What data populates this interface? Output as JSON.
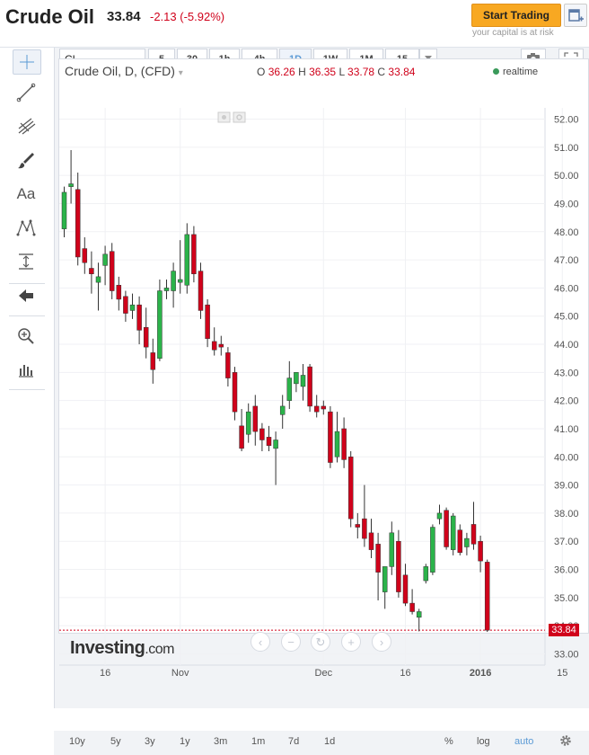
{
  "header": {
    "title": "Crude Oil",
    "price": "33.84",
    "change": "-2.13 (-5.92%)",
    "start_trading": "Start Trading",
    "risk_note": "your capital is at risk"
  },
  "toolbar": {
    "symbol": "CL",
    "timeframes": [
      "5",
      "30",
      "1h",
      "4h",
      "1D",
      "1W",
      "1M",
      "15"
    ],
    "active_timeframe": "1D"
  },
  "legend": {
    "name": "Crude Oil, D, (CFD)",
    "o_label": "O",
    "o": "36.26",
    "h_label": "H",
    "h": "36.35",
    "l_label": "L",
    "l": "33.78",
    "c_label": "C",
    "c": "33.84",
    "realtime": "realtime"
  },
  "logo": {
    "brand": "Investing",
    "suffix": ".com"
  },
  "last_price_label": "33.84",
  "bottom": {
    "ranges": [
      "10y",
      "5y",
      "3y",
      "1y",
      "3m",
      "1m",
      "7d",
      "1d"
    ],
    "pct": "%",
    "log": "log",
    "auto": "auto"
  },
  "colors": {
    "up": "#2bb34a",
    "down": "#d0021b",
    "accent": "#5b9ad5",
    "button": "#f8a822"
  },
  "chart_data": {
    "type": "candlestick",
    "title": "Crude Oil, D, (CFD)",
    "y_ticks": [
      "52.00",
      "51.00",
      "50.00",
      "49.00",
      "48.00",
      "47.00",
      "46.00",
      "45.00",
      "44.00",
      "43.00",
      "42.00",
      "41.00",
      "40.00",
      "39.00",
      "38.00",
      "37.00",
      "36.00",
      "35.00",
      "34.00",
      "33.00"
    ],
    "ylim": [
      32.6,
      52.4
    ],
    "x_ticks": [
      {
        "label": "16",
        "i": 6
      },
      {
        "label": "Nov",
        "i": 17
      },
      {
        "label": "Dec",
        "i": 38
      },
      {
        "label": "16",
        "i": 50
      },
      {
        "label": "2016",
        "i": 61
      },
      {
        "label": "15",
        "i": 73
      }
    ],
    "candles": [
      {
        "o": 48.1,
        "h": 49.6,
        "l": 47.8,
        "c": 49.4
      },
      {
        "o": 49.6,
        "h": 50.9,
        "l": 49.0,
        "c": 49.7
      },
      {
        "o": 49.5,
        "h": 50.1,
        "l": 46.8,
        "c": 47.1
      },
      {
        "o": 47.4,
        "h": 47.8,
        "l": 46.5,
        "c": 46.9
      },
      {
        "o": 46.7,
        "h": 47.3,
        "l": 45.8,
        "c": 46.5
      },
      {
        "o": 46.2,
        "h": 46.9,
        "l": 45.2,
        "c": 46.4
      },
      {
        "o": 46.8,
        "h": 47.5,
        "l": 46.1,
        "c": 47.2
      },
      {
        "o": 47.3,
        "h": 47.6,
        "l": 45.6,
        "c": 45.9
      },
      {
        "o": 46.1,
        "h": 46.4,
        "l": 45.2,
        "c": 45.6
      },
      {
        "o": 45.7,
        "h": 45.9,
        "l": 44.8,
        "c": 45.1
      },
      {
        "o": 45.2,
        "h": 45.8,
        "l": 44.9,
        "c": 45.4
      },
      {
        "o": 45.4,
        "h": 45.7,
        "l": 44.0,
        "c": 44.5
      },
      {
        "o": 44.6,
        "h": 45.3,
        "l": 43.5,
        "c": 43.9
      },
      {
        "o": 43.7,
        "h": 44.2,
        "l": 42.6,
        "c": 43.1
      },
      {
        "o": 43.5,
        "h": 46.3,
        "l": 43.4,
        "c": 45.9
      },
      {
        "o": 45.9,
        "h": 46.3,
        "l": 45.6,
        "c": 46.0
      },
      {
        "o": 45.9,
        "h": 46.9,
        "l": 45.3,
        "c": 46.6
      },
      {
        "o": 46.2,
        "h": 47.7,
        "l": 45.8,
        "c": 46.3
      },
      {
        "o": 46.1,
        "h": 48.3,
        "l": 45.8,
        "c": 47.9
      },
      {
        "o": 47.9,
        "h": 48.2,
        "l": 46.2,
        "c": 46.5
      },
      {
        "o": 46.6,
        "h": 46.9,
        "l": 44.9,
        "c": 45.2
      },
      {
        "o": 45.4,
        "h": 45.6,
        "l": 43.9,
        "c": 44.2
      },
      {
        "o": 44.1,
        "h": 44.6,
        "l": 43.6,
        "c": 43.8
      },
      {
        "o": 44.0,
        "h": 44.3,
        "l": 43.6,
        "c": 43.9
      },
      {
        "o": 43.7,
        "h": 43.9,
        "l": 42.5,
        "c": 42.8
      },
      {
        "o": 43.0,
        "h": 43.2,
        "l": 41.3,
        "c": 41.6
      },
      {
        "o": 41.1,
        "h": 41.7,
        "l": 40.2,
        "c": 40.3
      },
      {
        "o": 40.8,
        "h": 41.9,
        "l": 40.5,
        "c": 41.6
      },
      {
        "o": 41.8,
        "h": 42.2,
        "l": 40.4,
        "c": 40.9
      },
      {
        "o": 41.0,
        "h": 41.2,
        "l": 40.2,
        "c": 40.6
      },
      {
        "o": 40.7,
        "h": 41.1,
        "l": 40.2,
        "c": 40.4
      },
      {
        "o": 40.3,
        "h": 40.9,
        "l": 39.0,
        "c": 40.6
      },
      {
        "o": 41.5,
        "h": 42.2,
        "l": 41.0,
        "c": 41.8
      },
      {
        "o": 42.0,
        "h": 43.4,
        "l": 41.7,
        "c": 42.8
      },
      {
        "o": 42.6,
        "h": 43.0,
        "l": 42.3,
        "c": 43.0
      },
      {
        "o": 42.5,
        "h": 43.3,
        "l": 42.0,
        "c": 42.9
      },
      {
        "o": 43.2,
        "h": 43.3,
        "l": 41.6,
        "c": 41.8
      },
      {
        "o": 41.8,
        "h": 42.2,
        "l": 41.4,
        "c": 41.6
      },
      {
        "o": 41.8,
        "h": 42.0,
        "l": 41.5,
        "c": 41.7
      },
      {
        "o": 41.6,
        "h": 41.8,
        "l": 39.6,
        "c": 39.8
      },
      {
        "o": 40.0,
        "h": 41.6,
        "l": 39.8,
        "c": 40.9
      },
      {
        "o": 41.0,
        "h": 41.4,
        "l": 39.6,
        "c": 39.9
      },
      {
        "o": 40.0,
        "h": 40.2,
        "l": 37.5,
        "c": 37.8
      },
      {
        "o": 37.6,
        "h": 38.0,
        "l": 37.1,
        "c": 37.5
      },
      {
        "o": 37.8,
        "h": 39.0,
        "l": 36.8,
        "c": 37.1
      },
      {
        "o": 37.3,
        "h": 37.8,
        "l": 36.4,
        "c": 36.7
      },
      {
        "o": 36.9,
        "h": 37.3,
        "l": 34.9,
        "c": 35.9
      },
      {
        "o": 35.2,
        "h": 36.1,
        "l": 34.6,
        "c": 36.1
      },
      {
        "o": 36.1,
        "h": 37.7,
        "l": 35.8,
        "c": 37.3
      },
      {
        "o": 37.0,
        "h": 37.4,
        "l": 35.0,
        "c": 35.2
      },
      {
        "o": 35.8,
        "h": 36.2,
        "l": 34.7,
        "c": 34.8
      },
      {
        "o": 34.8,
        "h": 35.3,
        "l": 34.4,
        "c": 34.5
      },
      {
        "o": 34.3,
        "h": 34.6,
        "l": 33.8,
        "c": 34.5
      },
      {
        "o": 35.6,
        "h": 36.2,
        "l": 35.5,
        "c": 36.1
      },
      {
        "o": 35.9,
        "h": 37.6,
        "l": 35.8,
        "c": 37.5
      },
      {
        "o": 37.8,
        "h": 38.3,
        "l": 37.6,
        "c": 38.0
      },
      {
        "o": 38.1,
        "h": 38.2,
        "l": 36.7,
        "c": 36.8
      },
      {
        "o": 36.7,
        "h": 38.0,
        "l": 36.5,
        "c": 37.9
      },
      {
        "o": 37.4,
        "h": 37.6,
        "l": 36.5,
        "c": 36.6
      },
      {
        "o": 36.8,
        "h": 37.3,
        "l": 36.5,
        "c": 37.1
      },
      {
        "o": 37.6,
        "h": 38.4,
        "l": 36.7,
        "c": 36.9
      },
      {
        "o": 37.0,
        "h": 37.2,
        "l": 35.9,
        "c": 36.3
      },
      {
        "o": 36.26,
        "h": 36.35,
        "l": 33.78,
        "c": 33.84
      }
    ],
    "last_price": 33.84
  }
}
